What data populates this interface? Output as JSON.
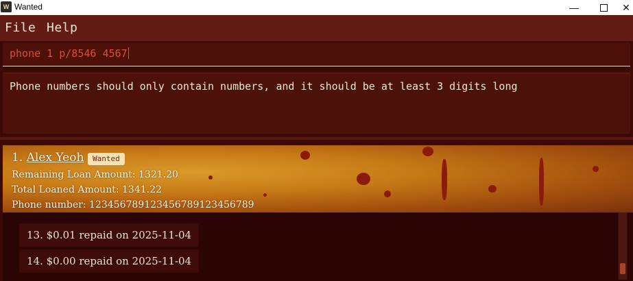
{
  "window": {
    "title": "Wanted",
    "app_icon_text": "W"
  },
  "menu": {
    "file": "File",
    "help": "Help"
  },
  "command": {
    "value": "phone 1 p/8546 4567"
  },
  "result": {
    "message": "Phone numbers should only contain numbers, and it should be at least 3 digits long"
  },
  "person": {
    "index": "1.",
    "name": "Alex Yeoh",
    "tag": "Wanted",
    "remaining": "Remaining Loan Amount: 1321.20",
    "total": "Total Loaned Amount: 1341.22",
    "phone": "Phone number: 123456789123456789123456789"
  },
  "repayments": [
    {
      "text": "13. $0.01 repaid on 2025-11-04"
    },
    {
      "text": "14. $0.00 repaid on 2025-11-04"
    }
  ],
  "colors": {
    "menubar": "#621c14",
    "command_text": "#d9512f",
    "background": "#3a0a07"
  }
}
